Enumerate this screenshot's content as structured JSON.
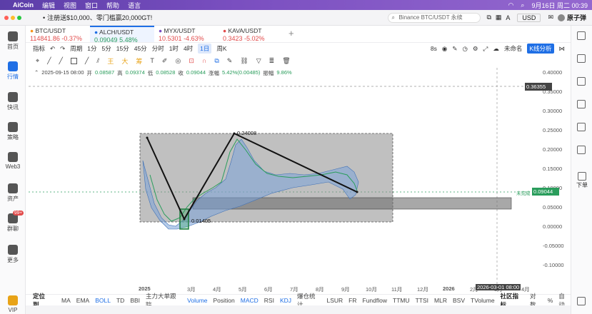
{
  "mac": {
    "app": "AiCoin",
    "menus": [
      "编辑",
      "视图",
      "窗口",
      "帮助",
      "语言"
    ],
    "time": "9月16日 周二  00:39"
  },
  "header": {
    "promo": "注册送$10,000、零门槛赢20,000GT!",
    "search_placeholder": "Binance BTC/USDT 永续",
    "currency": "USD",
    "user": "原子弹"
  },
  "sidebar": [
    {
      "label": "首页",
      "name": "home"
    },
    {
      "label": "行情",
      "name": "market",
      "active": true
    },
    {
      "label": "快讯",
      "name": "news"
    },
    {
      "label": "策略",
      "name": "strategy"
    },
    {
      "label": "Web3",
      "name": "web3"
    },
    {
      "label": "资产",
      "name": "assets"
    },
    {
      "label": "群聊",
      "name": "chat",
      "badge": "99+"
    },
    {
      "label": "更多",
      "name": "more"
    },
    {
      "label": "VIP",
      "name": "vip"
    }
  ],
  "tickers": [
    {
      "pair": "BTC/USDT",
      "price": "114841.86",
      "change": "-0.37%",
      "dir": "neg"
    },
    {
      "pair": "ALCH/USDT",
      "price": "0.09049",
      "change": "5.48%",
      "dir": "pos",
      "active": true
    },
    {
      "pair": "MYX/USDT",
      "price": "10.5301",
      "change": "-4.63%",
      "dir": "neg"
    },
    {
      "pair": "KAVA/USDT",
      "price": "0.3423",
      "change": "-5.02%",
      "dir": "neg"
    }
  ],
  "toolbar1": {
    "indicator": "指标",
    "period": "周期",
    "intervals": [
      "1分",
      "5分",
      "15分",
      "45分",
      "分时",
      "1时",
      "4时",
      "1日",
      "周K"
    ],
    "active_interval": "1日",
    "right": [
      "8s",
      "未命名",
      "K线分析"
    ]
  },
  "toolbar2": [
    "王",
    "大",
    "筹"
  ],
  "ohlc": {
    "date": "2025-09-15 08:00",
    "open_l": "开",
    "open": "0.08587",
    "high_l": "高",
    "high": "0.09374",
    "low_l": "低",
    "low": "0.08528",
    "close_l": "收",
    "close": "0.09044",
    "chg_l": "涨幅",
    "chg": "5.42%(0.00485)",
    "amp_l": "振幅",
    "amp": "9.86%"
  },
  "yaxis": {
    "ticks": [
      "0.40000",
      "0.35000",
      "0.30000",
      "0.25000",
      "0.20000",
      "0.15000",
      "0.10000",
      "0.05000",
      "0.00000",
      "-0.05000",
      "-0.10000"
    ],
    "crosshair_price": "0.36355",
    "last_price": "0.09044"
  },
  "xaxis": {
    "ticks": [
      "2025",
      "3月",
      "4月",
      "5月",
      "6月",
      "7月",
      "8月",
      "9月",
      "10月",
      "11月",
      "12月",
      "2026",
      "2月",
      "3月",
      "4月"
    ],
    "crosshair_time": "2026-03-01 08:00"
  },
  "annotations": {
    "high": "0.24008",
    "low": "0.01405",
    "hidden_label": "未完成"
  },
  "bottom": {
    "items": [
      "定位到...",
      "MA",
      "EMA",
      "BOLL",
      "TD",
      "BBI",
      "主力大单跟踪",
      "Volume",
      "Position",
      "MACD",
      "RSI",
      "KDJ",
      "爆仓统计",
      "LSUR",
      "FR",
      "Fundflow",
      "TTMU",
      "TTSI",
      "MLR",
      "BSV",
      "TVolume",
      "社区指标",
      "对数",
      "%",
      "自动"
    ]
  },
  "right_rail": {
    "order_label": "下单"
  },
  "colors": {
    "accent": "#1f6fe5",
    "up": "#2a9d5c",
    "down": "#e24b4b",
    "box": "#8c8c8c"
  }
}
